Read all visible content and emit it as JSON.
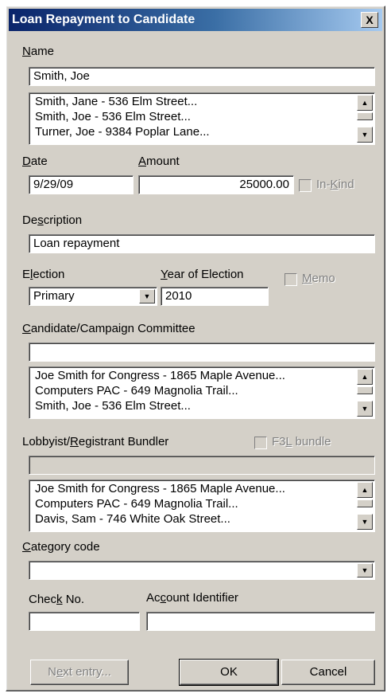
{
  "window": {
    "title": "Loan Repayment to Candidate",
    "close_glyph": "X"
  },
  "name": {
    "label": "Name",
    "value": "Smith, Joe",
    "suggestions": [
      "Smith, Jane - 536 Elm Street...",
      "Smith, Joe - 536 Elm Street...",
      "Turner, Joe - 9384 Poplar Lane..."
    ]
  },
  "date": {
    "label": "Date",
    "value": "9/29/09"
  },
  "amount": {
    "label": "Amount",
    "value": "25000.00"
  },
  "in_kind": {
    "label": "In-Kind",
    "checked": false
  },
  "description": {
    "label": "Description",
    "value": "Loan repayment"
  },
  "election": {
    "label": "Election",
    "value": "Primary"
  },
  "year_of_election": {
    "label": "Year of Election",
    "value": "2010"
  },
  "memo": {
    "label": "Memo",
    "checked": false
  },
  "candidate_committee": {
    "label": "Candidate/Campaign Committee",
    "value": "",
    "suggestions": [
      "Joe Smith for Congress - 1865 Maple Avenue...",
      "Computers PAC - 649 Magnolia Trail...",
      "Smith, Joe - 536 Elm Street..."
    ]
  },
  "bundler": {
    "label": "Lobbyist/Registrant Bundler",
    "value": "",
    "f3l_label": "F3L bundle",
    "suggestions": [
      "Joe Smith for Congress - 1865 Maple Avenue...",
      "Computers PAC - 649 Magnolia Trail...",
      "Davis, Sam - 746 White Oak Street..."
    ]
  },
  "category": {
    "label": "Category code",
    "value": ""
  },
  "check_no": {
    "label": "Check No.",
    "value": ""
  },
  "account_identifier": {
    "label": "Account Identifier",
    "value": ""
  },
  "buttons": {
    "next_entry": "Next entry...",
    "ok": "OK",
    "cancel": "Cancel"
  },
  "glyphs": {
    "up": "▲",
    "down": "▼"
  }
}
